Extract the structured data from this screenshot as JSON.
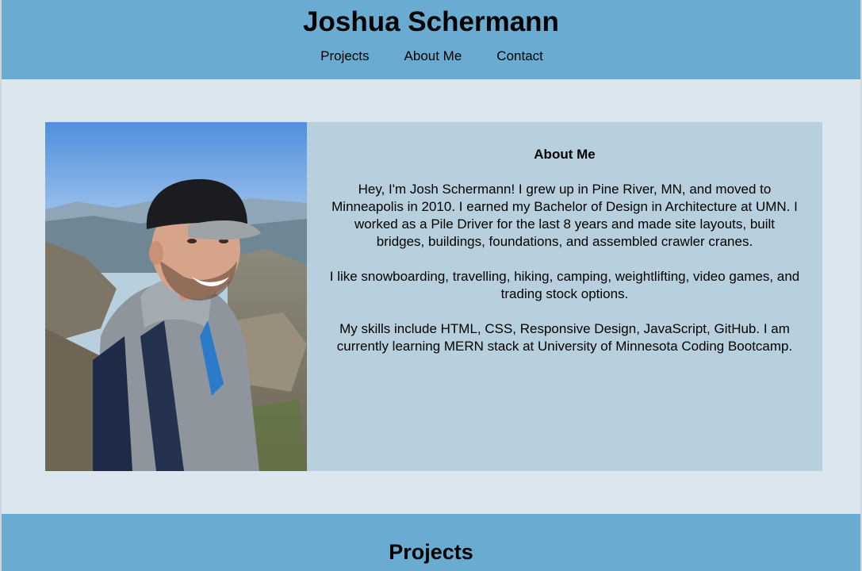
{
  "header": {
    "title": "Joshua Schermann",
    "nav": [
      "Projects",
      "About Me",
      "Contact"
    ]
  },
  "about": {
    "heading": "About Me",
    "paragraphs": [
      "Hey, I'm Josh Schermann! I grew up in Pine River, MN, and moved to Minneapolis in 2010. I earned my Bachelor of Design in Architecture at UMN. I worked as a Pile Driver for the last 8 years and made site layouts, built bridges, buildings, foundations, and assembled crawler cranes.",
      "I like snowboarding, travelling, hiking, camping, weightlifting, video games, and trading stock options.",
      "My skills include HTML, CSS, Responsive Design, JavaScript, GitHub. I am currently learning MERN stack at University of Minnesota Coding Bootcamp."
    ]
  },
  "projects": {
    "heading": "Projects"
  },
  "colors": {
    "header_bg": "#6aabd2",
    "page_bg": "#dce6ee",
    "about_bg": "#b8d0de"
  }
}
